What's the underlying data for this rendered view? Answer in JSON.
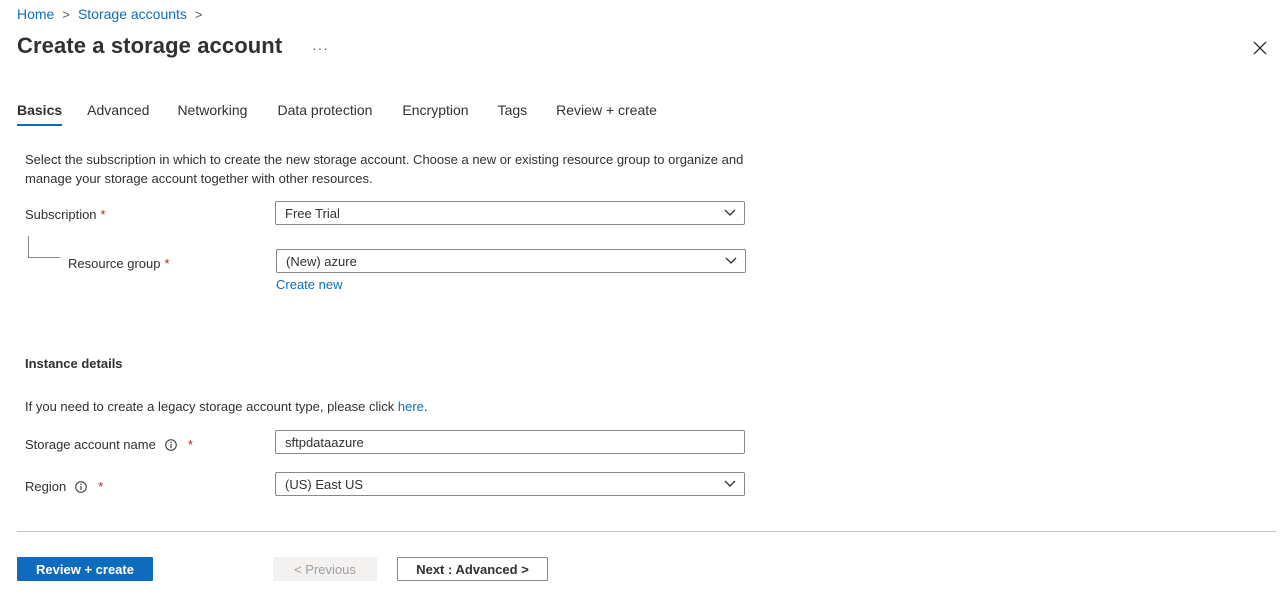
{
  "breadcrumb": {
    "home": "Home",
    "storage_accounts": "Storage accounts",
    "separator": ">"
  },
  "page": {
    "title": "Create a storage account",
    "more": "···"
  },
  "tabs": [
    {
      "label": "Basics",
      "active": true
    },
    {
      "label": "Advanced"
    },
    {
      "label": "Networking"
    },
    {
      "label": "Data protection"
    },
    {
      "label": "Encryption"
    },
    {
      "label": "Tags"
    },
    {
      "label": "Review + create"
    }
  ],
  "intro": "Select the subscription in which to create the new storage account. Choose a new or existing resource group to organize and manage your storage account together with other resources.",
  "subscription": {
    "label": "Subscription",
    "required": "*",
    "value": "Free Trial"
  },
  "resource_group": {
    "label": "Resource group",
    "required": "*",
    "value": "(New) azure",
    "create_new": "Create new"
  },
  "instance": {
    "title": "Instance details",
    "legacy_text": "If you need to create a legacy storage account type, please click ",
    "legacy_link": "here",
    "legacy_end": "."
  },
  "storage_name": {
    "label": "Storage account name",
    "required": "*",
    "value": "sftpdataazure"
  },
  "region": {
    "label": "Region",
    "required": "*",
    "value": "(US) East US"
  },
  "buttons": {
    "review_create": "Review + create",
    "previous": "< Previous",
    "next": "Next : Advanced >"
  },
  "colors": {
    "accent": "#0f6cbd",
    "required": "#a4262c",
    "text": "#323130"
  },
  "icons": {
    "close": "close-icon",
    "more": "more-icon",
    "info": "info-icon",
    "chevron": "chevron-down-icon"
  }
}
